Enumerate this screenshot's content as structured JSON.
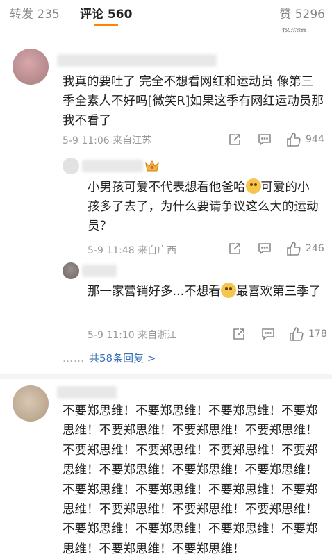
{
  "tabs": {
    "repost": "转发 235",
    "comment_label": "评论",
    "comment_count": "560",
    "like": "赞 5296"
  },
  "sort_hint": "按热度",
  "comments": [
    {
      "text": "我真的要吐了 完全不想看网红和运动员 像第三季全素人不好吗[微笑R]如果这季有网红运动员那我不看了",
      "time": "5-9 11:06",
      "location": "来自江苏",
      "likes": "944"
    },
    {
      "text": "不要郑思维！不要郑思维！不要郑思维！不要郑思维！不要郑思维！不要郑思维！不要郑思维！不要郑思维！不要郑思维！不要郑思维！不要郑思维！不要郑思维！不要郑思维！不要郑思维！不要郑思维！不要郑思维！不要郑思维！不要郑思维！不要郑思维！不要郑思维！不要郑思维！不要郑思维！不要郑思维！不要郑思维！不要郑思维！不要郑思维！不要郑思维！"
    }
  ],
  "replies": [
    {
      "text_a": "小男孩可爱不代表想看他爸哈",
      "emoji_a": "pleading-face-emoji",
      "text_b": "可爱的小孩多了去了，为什么要请争议这么大的运动员？",
      "time": "5-9 11:48",
      "location": "来自广西",
      "likes": "246"
    },
    {
      "text_a": "那一家营销好多...不想看",
      "emoji_a": "crying-face-emoji",
      "text_b": "最喜欢第三季了",
      "time": "5-9 11:10",
      "location": "来自浙江",
      "likes": "178"
    }
  ],
  "more_replies": {
    "dots": "……",
    "label": "共58条回复 >"
  },
  "colors": {
    "accent": "#ff8200",
    "link": "#3670b8",
    "meta": "#999999"
  }
}
